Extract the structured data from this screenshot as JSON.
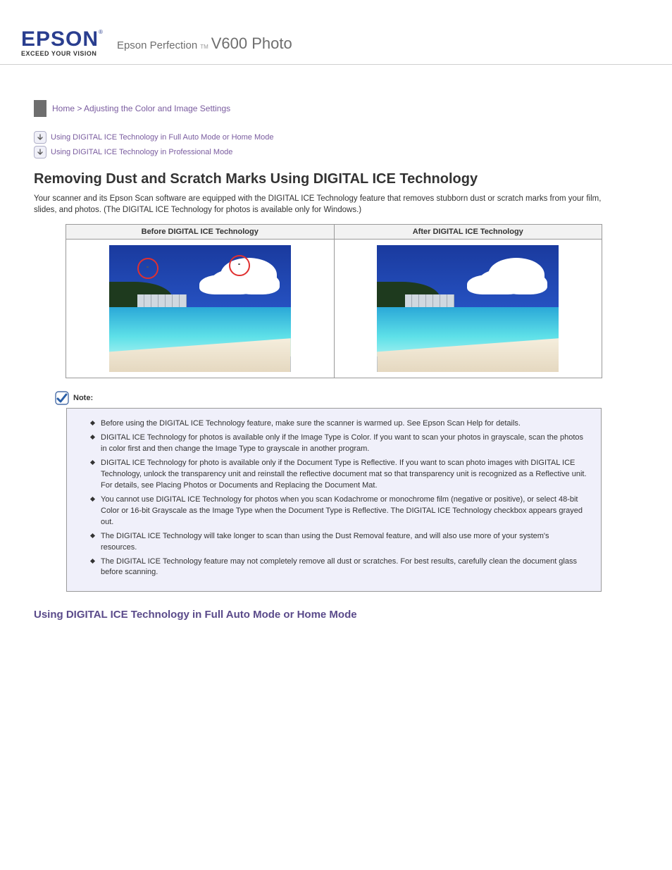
{
  "header": {
    "brand": "EPSON",
    "brand_tagline": "EXCEED YOUR VISION",
    "product_prefix": "Epson Perfection",
    "tm": "TM",
    "product_model": "V600 Photo"
  },
  "breadcrumb": {
    "home": "Home",
    "sep": " > ",
    "section": "Adjusting the Color and Image Settings"
  },
  "toc": [
    "Using DIGITAL ICE Technology in Full Auto Mode or Home Mode",
    "Using DIGITAL ICE Technology in Professional Mode"
  ],
  "title": "Removing Dust and Scratch Marks Using DIGITAL ICE Technology",
  "intro": "Your scanner and its Epson Scan software are equipped with the DIGITAL ICE Technology feature that removes stubborn dust or scratch marks from your film, slides, and photos. (The DIGITAL ICE Technology for photos is available only for Windows.)",
  "comparison": {
    "before_label": "Before DIGITAL ICE Technology",
    "after_label": "After DIGITAL ICE Technology"
  },
  "note_label": "Note:",
  "notes": [
    "Before using the DIGITAL ICE Technology feature, make sure the scanner is warmed up. See Epson Scan Help for details.",
    "DIGITAL ICE Technology for photos is available only if the Image Type is Color. If you want to scan your photos in grayscale, scan the photos in color first and then change the Image Type to grayscale in another program.",
    "DIGITAL ICE Technology for photo is available only if the Document Type is Reflective. If you want to scan photo images with DIGITAL ICE Technology, unlock the transparency unit and reinstall the reflective document mat so that transparency unit is recognized as a Reflective unit. For details, see Placing Photos or Documents and Replacing the Document Mat.",
    "You cannot use DIGITAL ICE Technology for photos when you scan Kodachrome or monochrome film (negative or positive), or select 48-bit Color or 16-bit Grayscale as the Image Type when the Document Type is Reflective. The DIGITAL ICE Technology checkbox appears grayed out.",
    "The DIGITAL ICE Technology will take longer to scan than using the Dust Removal feature, and will also use more of your system's resources.",
    "The DIGITAL ICE Technology feature may not completely remove all dust or scratches. For best results, carefully clean the document glass before scanning."
  ],
  "section_heading": "Using DIGITAL ICE Technology in Full Auto Mode or Home Mode"
}
